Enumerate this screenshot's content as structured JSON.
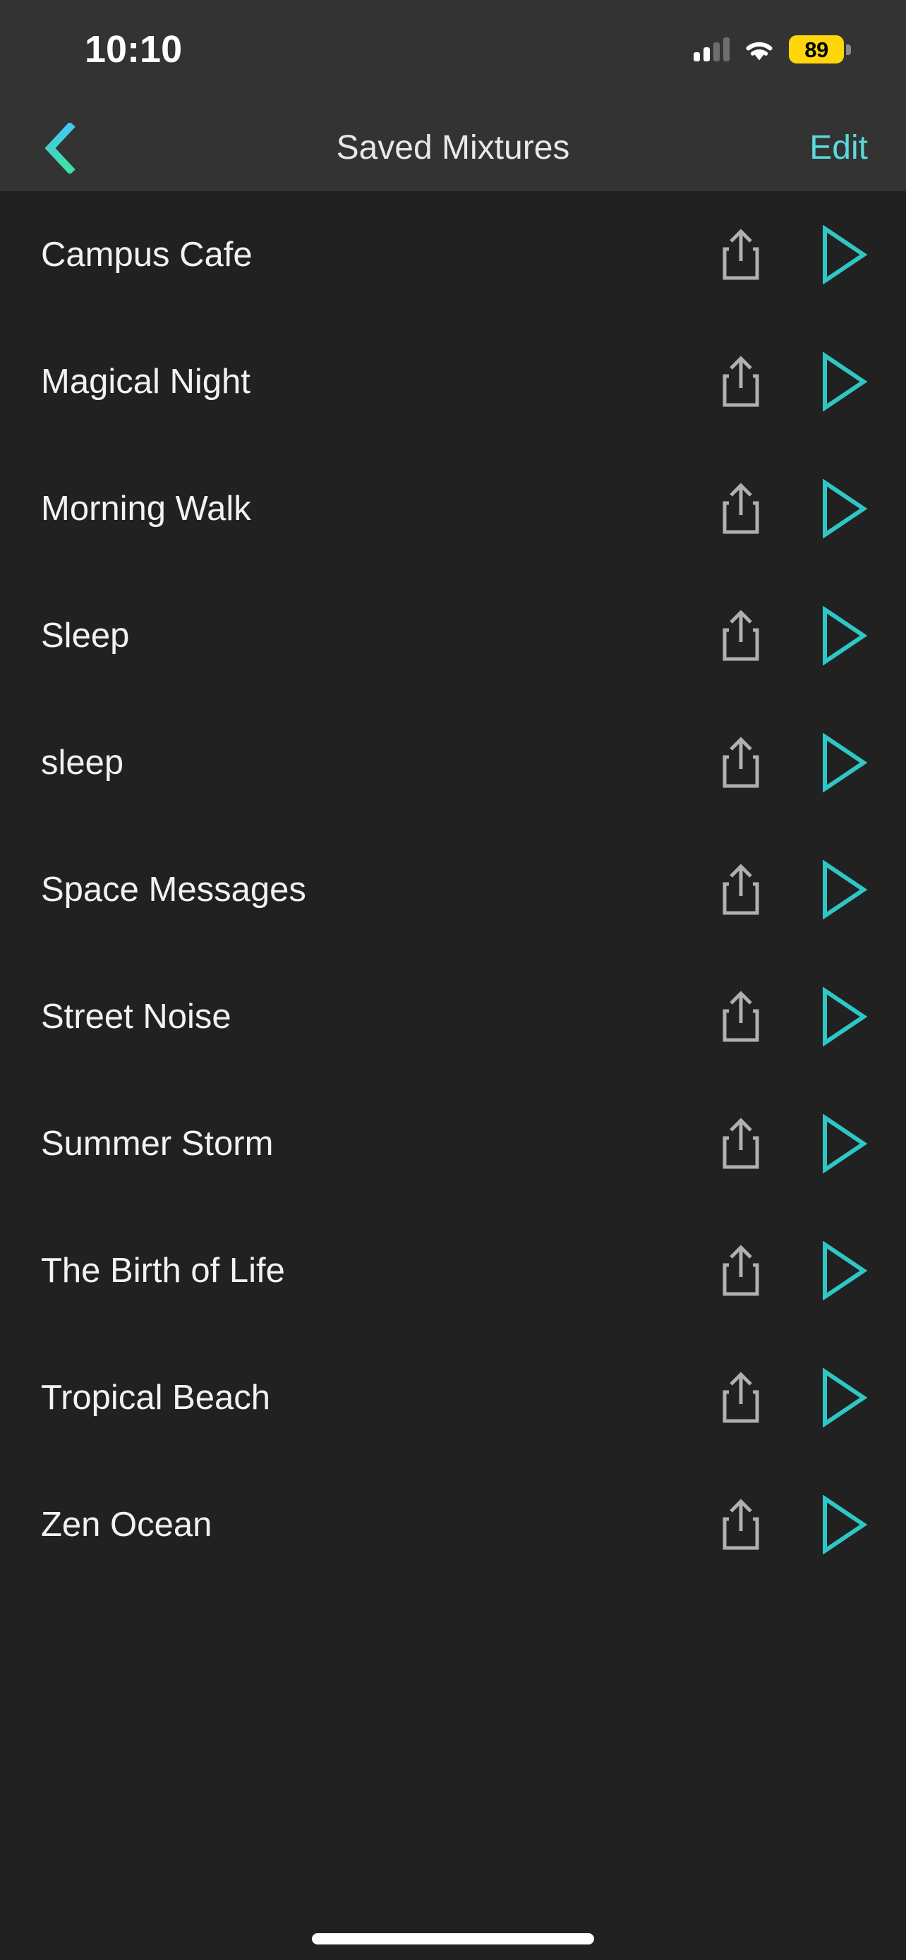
{
  "status_bar": {
    "time": "10:10",
    "battery_percent": "89",
    "icons": {
      "cellular": "cellular-signal-icon",
      "wifi": "wifi-icon",
      "battery": "battery-icon"
    },
    "colors": {
      "background": "#333333",
      "battery_fill": "#ffd60a",
      "battery_text": "#000000",
      "signal_active": "#ffffff",
      "signal_inactive": "#6e6e6e"
    }
  },
  "nav_bar": {
    "back_label": "back-chevron",
    "title": "Saved Mixtures",
    "edit_label": "Edit",
    "colors": {
      "background": "#333333",
      "title": "#e8e8e8",
      "accent": "#5bd8dd",
      "chevron_top": "#44c8ef",
      "chevron_bottom": "#3ee0a8"
    }
  },
  "list": {
    "background": "#212121",
    "share_icon_color": "#b0b0b0",
    "play_icon_color": "#2fc6c6",
    "title_color": "#f2f2f2",
    "items": [
      {
        "title": "Campus Cafe",
        "share": "share-icon",
        "play": "play-icon"
      },
      {
        "title": "Magical Night",
        "share": "share-icon",
        "play": "play-icon"
      },
      {
        "title": "Morning Walk",
        "share": "share-icon",
        "play": "play-icon"
      },
      {
        "title": "Sleep",
        "share": "share-icon",
        "play": "play-icon"
      },
      {
        "title": "sleep",
        "share": "share-icon",
        "play": "play-icon"
      },
      {
        "title": "Space Messages",
        "share": "share-icon",
        "play": "play-icon"
      },
      {
        "title": "Street Noise",
        "share": "share-icon",
        "play": "play-icon"
      },
      {
        "title": "Summer Storm",
        "share": "share-icon",
        "play": "play-icon"
      },
      {
        "title": "The Birth of Life",
        "share": "share-icon",
        "play": "play-icon"
      },
      {
        "title": "Tropical Beach",
        "share": "share-icon",
        "play": "play-icon"
      },
      {
        "title": "Zen Ocean",
        "share": "share-icon",
        "play": "play-icon"
      }
    ]
  },
  "home_indicator": {
    "label": "home-indicator",
    "color": "#ffffff"
  }
}
